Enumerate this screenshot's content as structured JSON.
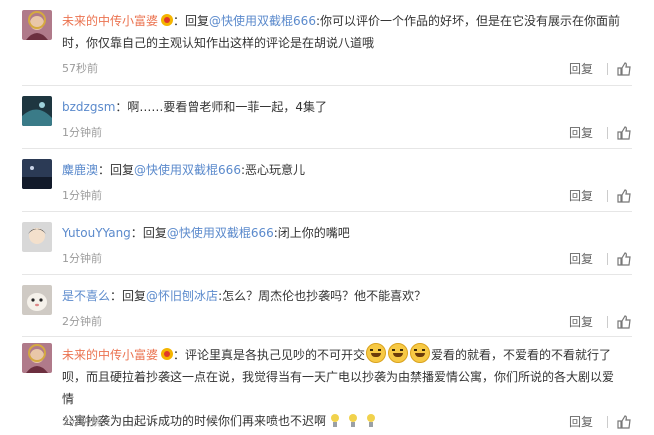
{
  "comments": [
    {
      "user": "未来的中传小富婆",
      "reply_word": "回复",
      "mention": "@快使用双截棍666",
      "text_line1": ":你可以评价一个作品的好坏，但是在它没有展示在你面前",
      "text_line2": "时，你仅靠自己的主观认知作出这样的评论是在胡说八道哦",
      "time": "57秒前",
      "reply_label": "回复"
    },
    {
      "user": "bzdzgsm",
      "text": "：啊……要看曾老师和一菲一起，4集了",
      "time": "1分钟前",
      "reply_label": "回复"
    },
    {
      "user": "麋鹿澳",
      "reply_word": "回复",
      "mention": "@快使用双截棍666",
      "text": ":恶心玩意儿",
      "time": "1分钟前",
      "reply_label": "回复"
    },
    {
      "user": "YutouYYang",
      "reply_word": "回复",
      "mention": "@快使用双截棍666",
      "text": ":闭上你的嘴吧",
      "time": "1分钟前",
      "reply_label": "回复"
    },
    {
      "user": "是不喜么",
      "reply_word": "回复",
      "mention": "@怀旧刨冰店",
      "text": ":怎么？周杰伦也抄袭吗？他不能喜欢？",
      "time": "2分钟前",
      "reply_label": "回复"
    },
    {
      "user": "未来的中传小富婆",
      "text_line1a": "：评论里真是各执己见吵的不可开交",
      "text_line1b": "爱看的就看，不爱看的不看就行了",
      "text_line2": "呗，而且硬拉着抄袭这一点在说，我觉得当有一天广电以抄袭为由禁播爱情公寓，你们所说的各大剧以爱情",
      "text_line3": "公寓抄袭为由起诉成功的时候你们再来喷也不迟啊",
      "time": "3分钟前",
      "reply_label": "回复"
    }
  ]
}
